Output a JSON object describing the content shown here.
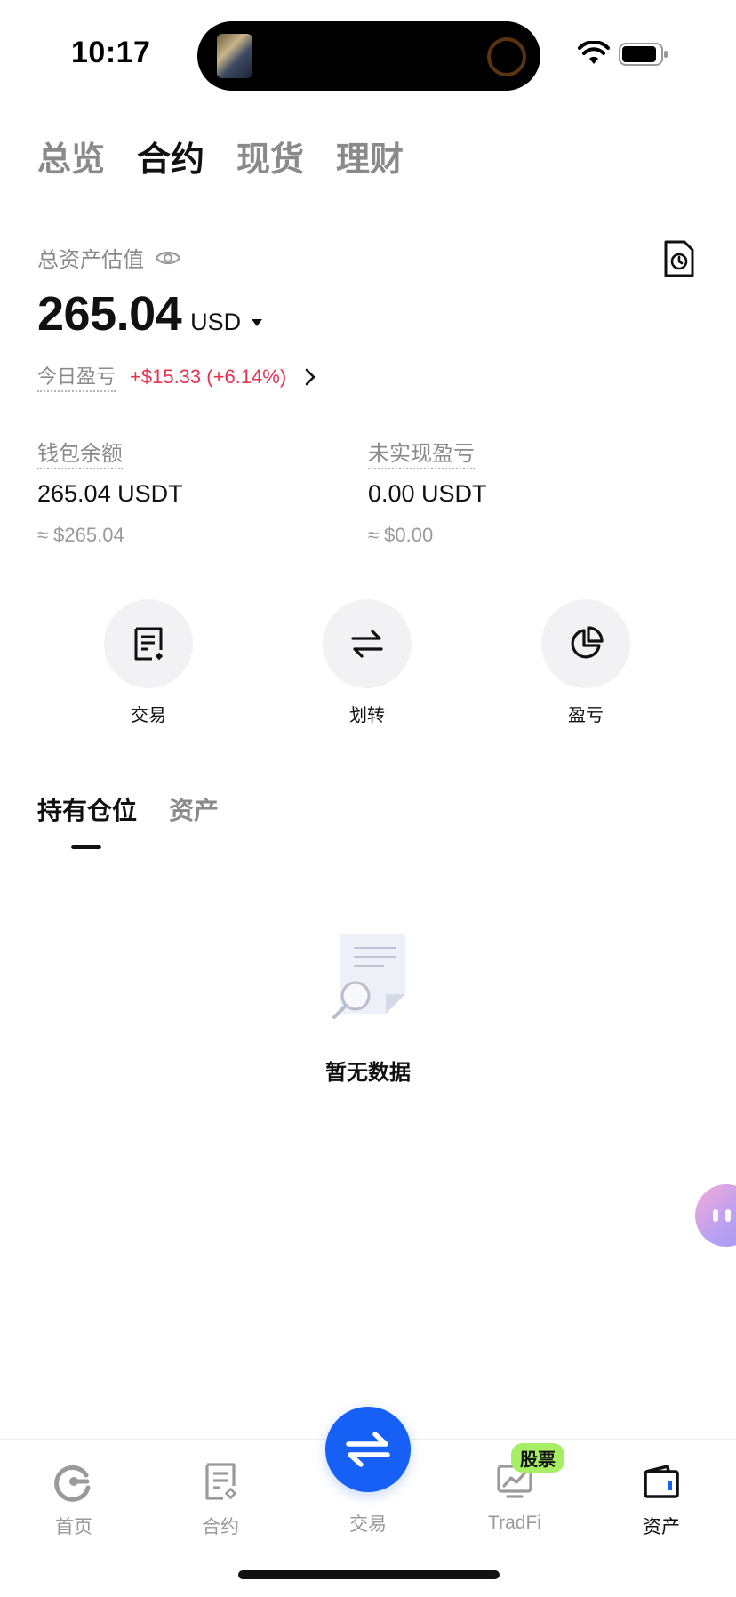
{
  "status_bar": {
    "time": "10:17"
  },
  "top_tabs": [
    {
      "label": "总览",
      "active": false
    },
    {
      "label": "合约",
      "active": true
    },
    {
      "label": "现货",
      "active": false
    },
    {
      "label": "理财",
      "active": false
    }
  ],
  "summary": {
    "label": "总资产估值",
    "amount": "265.04",
    "currency": "USD",
    "pnl_label": "今日盈亏",
    "pnl_value": "+$15.33 (+6.14%)"
  },
  "balances": [
    {
      "label": "钱包余额",
      "value": "265.04 USDT",
      "sub": "≈ $265.04"
    },
    {
      "label": "未实现盈亏",
      "value": "0.00 USDT",
      "sub": "≈ $0.00"
    }
  ],
  "actions": [
    {
      "label": "交易",
      "icon": "trade-doc-icon"
    },
    {
      "label": "划转",
      "icon": "transfer-arrows-icon"
    },
    {
      "label": "盈亏",
      "icon": "pie-chart-icon"
    }
  ],
  "sub_tabs": [
    {
      "label": "持有仓位",
      "active": true
    },
    {
      "label": "资产",
      "active": false
    }
  ],
  "empty_state": {
    "text": "暂无数据"
  },
  "bottom_nav": {
    "items": [
      {
        "label": "首页",
        "icon": "home-icon",
        "active": false
      },
      {
        "label": "合约",
        "icon": "contract-icon",
        "active": false
      },
      {
        "label": "交易",
        "icon": "swap-icon",
        "active": false
      },
      {
        "label": "TradFi",
        "icon": "tradfi-chart-icon",
        "active": false
      },
      {
        "label": "资产",
        "icon": "wallet-icon",
        "active": true
      }
    ],
    "badge": "股票"
  },
  "colors": {
    "accent": "#1660f5",
    "positive_pnl": "#e8324f",
    "badge": "#a6ee63"
  }
}
